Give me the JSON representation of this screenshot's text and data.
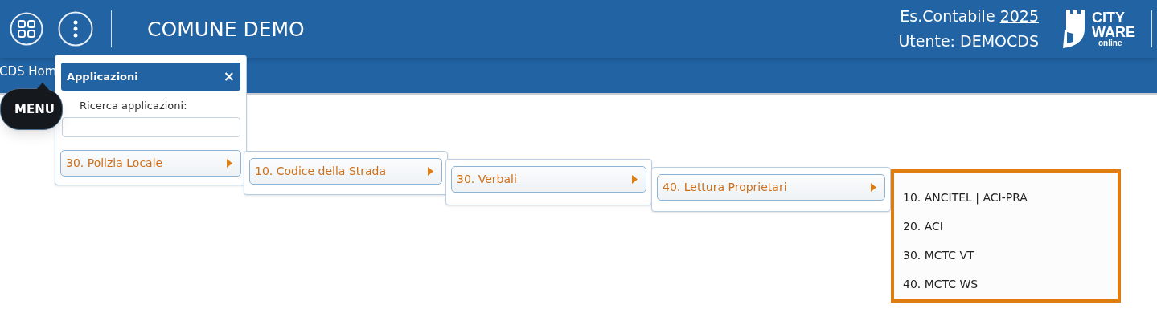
{
  "header": {
    "title": "COMUNE DEMO",
    "fiscal_year_label": "Es.Contabile",
    "fiscal_year": "2025",
    "user": "Utente: DEMOCDS",
    "logo": [
      "CITY",
      "WARE",
      "online"
    ]
  },
  "tab": {
    "label": "CDS Hom"
  },
  "applications_panel": {
    "title": "Applicazioni",
    "close": "×",
    "search_label": "Ricerca applicazioni:"
  },
  "tooltip": {
    "label": "MENU"
  },
  "menus": [
    {
      "highlighted": false,
      "items": [
        {
          "label": "30. Polizia Locale",
          "has_submenu": true
        }
      ]
    },
    {
      "highlighted": false,
      "items": [
        {
          "label": "10. Codice della Strada",
          "has_submenu": true
        }
      ]
    },
    {
      "highlighted": false,
      "items": [
        {
          "label": "30. Verbali",
          "has_submenu": true
        }
      ]
    },
    {
      "highlighted": false,
      "items": [
        {
          "label": "40. Lettura Proprietari",
          "has_submenu": true
        }
      ]
    },
    {
      "highlighted": true,
      "items": [
        {
          "label": "10. ANCITEL | ACI-PRA",
          "has_submenu": false
        },
        {
          "label": "20. ACI",
          "has_submenu": false
        },
        {
          "label": "30. MCTC VT",
          "has_submenu": false
        },
        {
          "label": "40. MCTC WS",
          "has_submenu": false
        }
      ]
    }
  ]
}
